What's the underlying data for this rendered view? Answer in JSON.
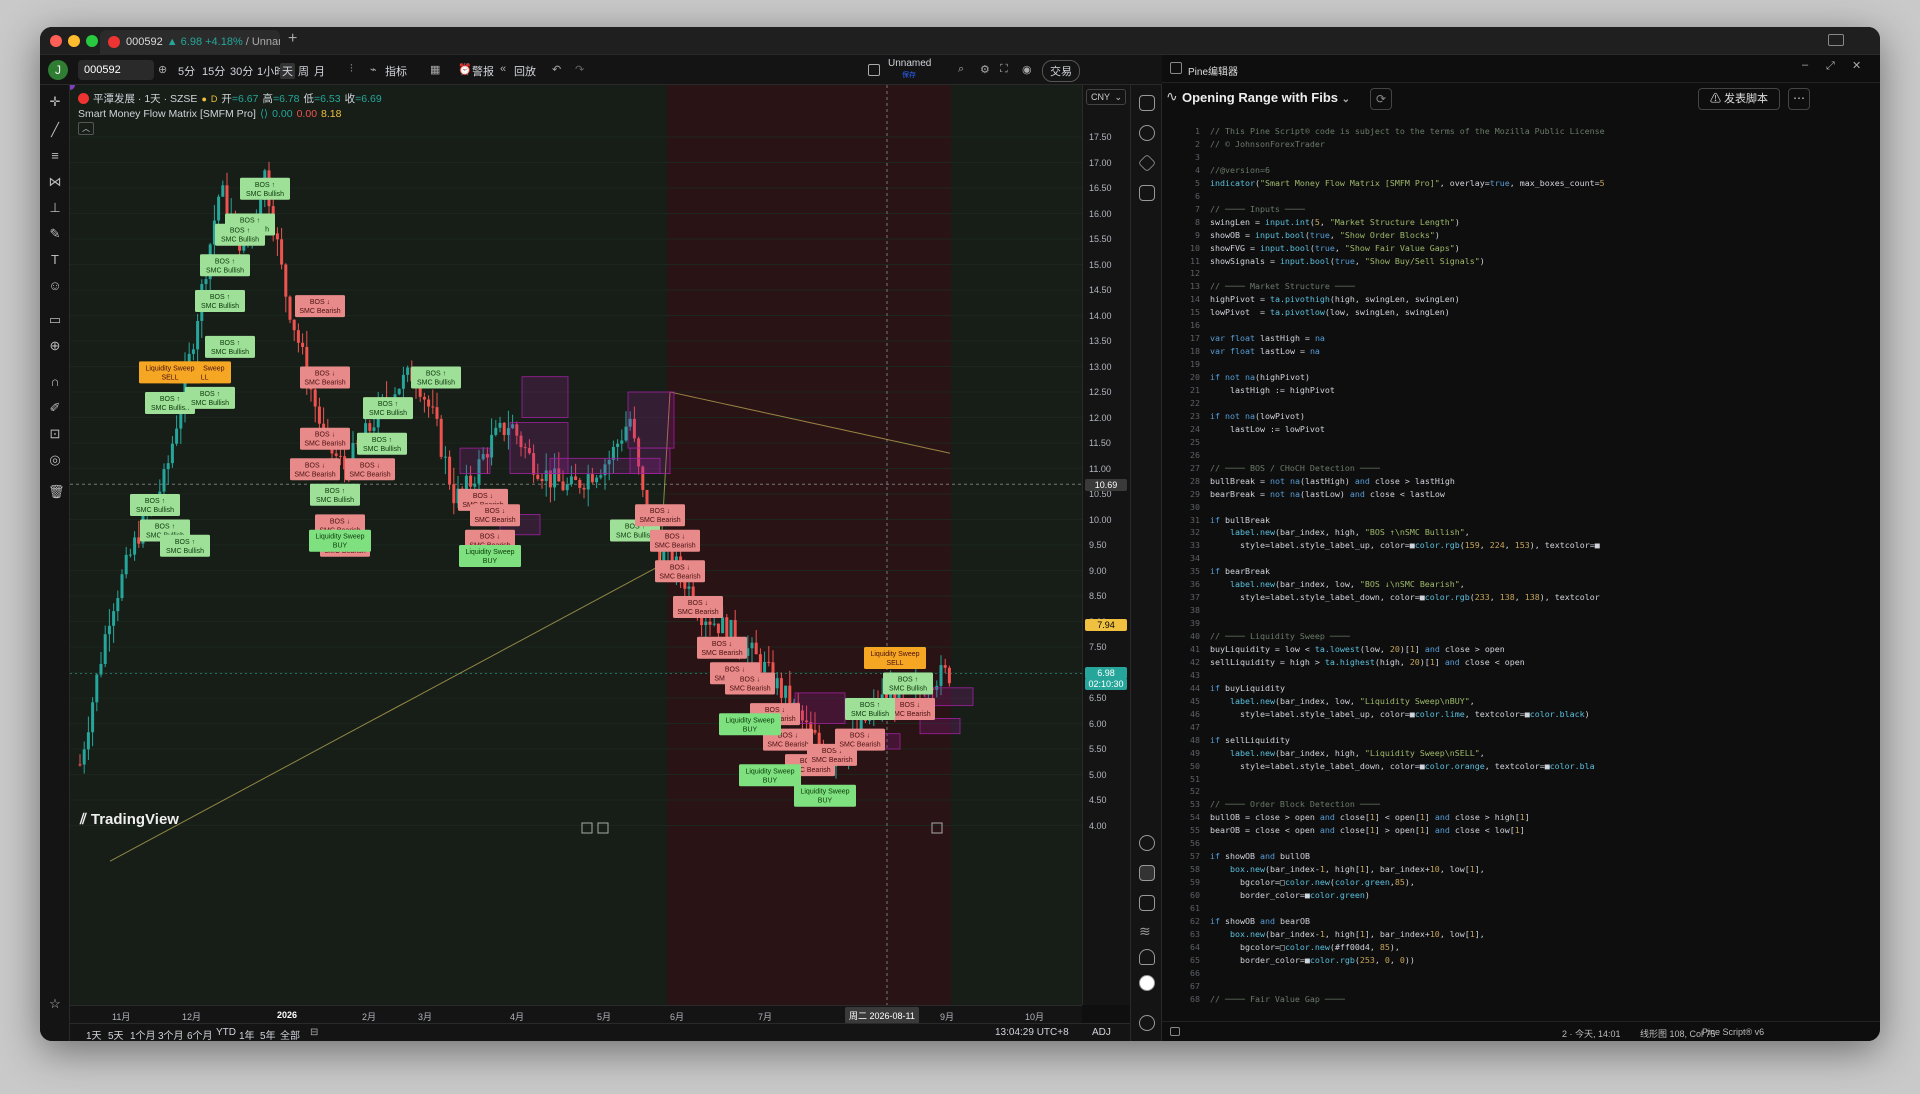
{
  "window": {
    "tab_title": "000592 ▲ 6.98 +4.18% / Unnam",
    "tab_symbol": "000592",
    "tab_change": "▲ 6.98 +4.18%",
    "tab_layout": "/ Unnam"
  },
  "toolbar": {
    "avatar": "J",
    "symbol": "000592",
    "intervals": [
      "5分",
      "15分",
      "30分",
      "1小时",
      "天",
      "周",
      "月"
    ],
    "indicators": "指标",
    "alert": "警报",
    "replay": "回放",
    "layout_name": "Unnamed",
    "layout_saved": "保存",
    "trade": "交易",
    "post": "发表"
  },
  "legend": {
    "symbol_line": "平潭发展 · 1天 · SZSE",
    "ohlc": {
      "open_label": "开",
      "open": "=6.67",
      "high_label": "高",
      "high": "=6.78",
      "low_label": "低",
      "low": "=6.53",
      "close_label": "收",
      "close": "=6.69"
    },
    "indicator_name": "Smart Money Flow Matrix [SMFM Pro]",
    "indicator_values": [
      "0.00",
      "0.00",
      "8.18"
    ]
  },
  "currency": "CNY",
  "price_axis": {
    "ticks": [
      "17.50",
      "17.00",
      "16.50",
      "16.00",
      "15.50",
      "15.00",
      "14.50",
      "14.00",
      "13.50",
      "13.00",
      "12.50",
      "12.00",
      "11.50",
      "11.00",
      "10.50",
      "10.00",
      "9.50",
      "9.00",
      "8.50",
      "8.00",
      "7.50",
      "7.00",
      "6.50",
      "6.00",
      "5.50",
      "5.00",
      "4.50",
      "4.00"
    ],
    "crosshair_price": "10.69",
    "ma_price": "7.94",
    "last_price": "6.98",
    "countdown": "02:10:30"
  },
  "time_axis": {
    "ticks": [
      "11月",
      "12月",
      "2026",
      "2月",
      "3月",
      "4月",
      "5月",
      "6月",
      "7月",
      "8月",
      "9月",
      "10月"
    ],
    "crosshair_date": "周二 2026-08-11"
  },
  "chart_labels": {
    "bos_bull": "BOS ↑\nSMC Bullish",
    "bos_bear": "BOS ↓\nSMC Bearish",
    "liq_sell": "Liquidity Sweep\nSELL",
    "liq_buy": "Liquidity Sweep\nBUY"
  },
  "brand": "TradingView",
  "bottom_bar": {
    "ranges": [
      "1天",
      "5天",
      "1个月",
      "3个月",
      "6个月",
      "YTD",
      "1年",
      "5年",
      "全部"
    ],
    "clock": "13:04:29 UTC+8",
    "adj": "ADJ"
  },
  "pine": {
    "panel_label": "Pine编辑器",
    "script_title": "Opening Range with Fibs",
    "publish": "发表脚本",
    "status_position": "2 · 今天, 14:01",
    "status_line": "线形图 108, Col 75",
    "status_version": "Pine Script® v6",
    "code_lines": [
      "// This Pine Script® code is subject to the terms of the Mozilla Public License",
      "// © JohnsonForexTrader",
      "",
      "//@version=6",
      "indicator(\"Smart Money Flow Matrix [SMFM Pro]\", overlay=true, max_boxes_count=5",
      "",
      "// ──── Inputs ────",
      "swingLen = input.int(5, \"Market Structure Length\")",
      "showOB = input.bool(true, \"Show Order Blocks\")",
      "showFVG = input.bool(true, \"Show Fair Value Gaps\")",
      "showSignals = input.bool(true, \"Show Buy/Sell Signals\")",
      "",
      "// ──── Market Structure ────",
      "highPivot = ta.pivothigh(high, swingLen, swingLen)",
      "lowPivot  = ta.pivotlow(low, swingLen, swingLen)",
      "",
      "var float lastHigh = na",
      "var float lastLow = na",
      "",
      "if not na(highPivot)",
      "    lastHigh := highPivot",
      "",
      "if not na(lowPivot)",
      "    lastLow := lowPivot",
      "",
      "",
      "// ──── BOS / CHoCH Detection ────",
      "bullBreak = not na(lastHigh) and close > lastHigh",
      "bearBreak = not na(lastLow) and close < lastLow",
      "",
      "if bullBreak",
      "    label.new(bar_index, high, \"BOS ↑\\nSMC Bullish\",",
      "      style=label.style_label_up, color=■color.rgb(159, 224, 153), textcolor=■",
      "",
      "if bearBreak",
      "    label.new(bar_index, low, \"BOS ↓\\nSMC Bearish\",",
      "      style=label.style_label_down, color=■color.rgb(233, 138, 138), textcolor",
      "",
      "",
      "// ──── Liquidity Sweep ────",
      "buyLiquidity = low < ta.lowest(low, 20)[1] and close > open",
      "sellLiquidity = high > ta.highest(high, 20)[1] and close < open",
      "",
      "if buyLiquidity",
      "    label.new(bar_index, low, \"Liquidity Sweep\\nBUY\",",
      "      style=label.style_label_up, color=■color.lime, textcolor=■color.black)",
      "",
      "if sellLiquidity",
      "    label.new(bar_index, high, \"Liquidity Sweep\\nSELL\",",
      "      style=label.style_label_down, color=■color.orange, textcolor=■color.bla",
      "",
      "",
      "// ──── Order Block Detection ────",
      "bullOB = close > open and close[1] < open[1] and close > high[1]",
      "bearOB = close < open and close[1] > open[1] and close < low[1]",
      "",
      "if showOB and bullOB",
      "    box.new(bar_index-1, high[1], bar_index+10, low[1],",
      "      bgcolor=□color.new(color.green,85),",
      "      border_color=■color.green)",
      "",
      "if showOB and bearOB",
      "    box.new(bar_index-1, high[1], bar_index+10, low[1],",
      "      bgcolor=□color.new(#ff00d4, 85),",
      "      border_color=■color.rgb(253, 0, 0))",
      "",
      "",
      "// ──── Fair Value Gap ────"
    ]
  },
  "colors": {
    "up": "#26a69a",
    "down": "#ef5350",
    "bull_label": "#9fe099",
    "bear_label": "#e98a8a",
    "liq_sell": "#f5a623",
    "liq_buy": "#7ee07e",
    "ma": "#c9b458",
    "ob_box": "#a020a0"
  }
}
